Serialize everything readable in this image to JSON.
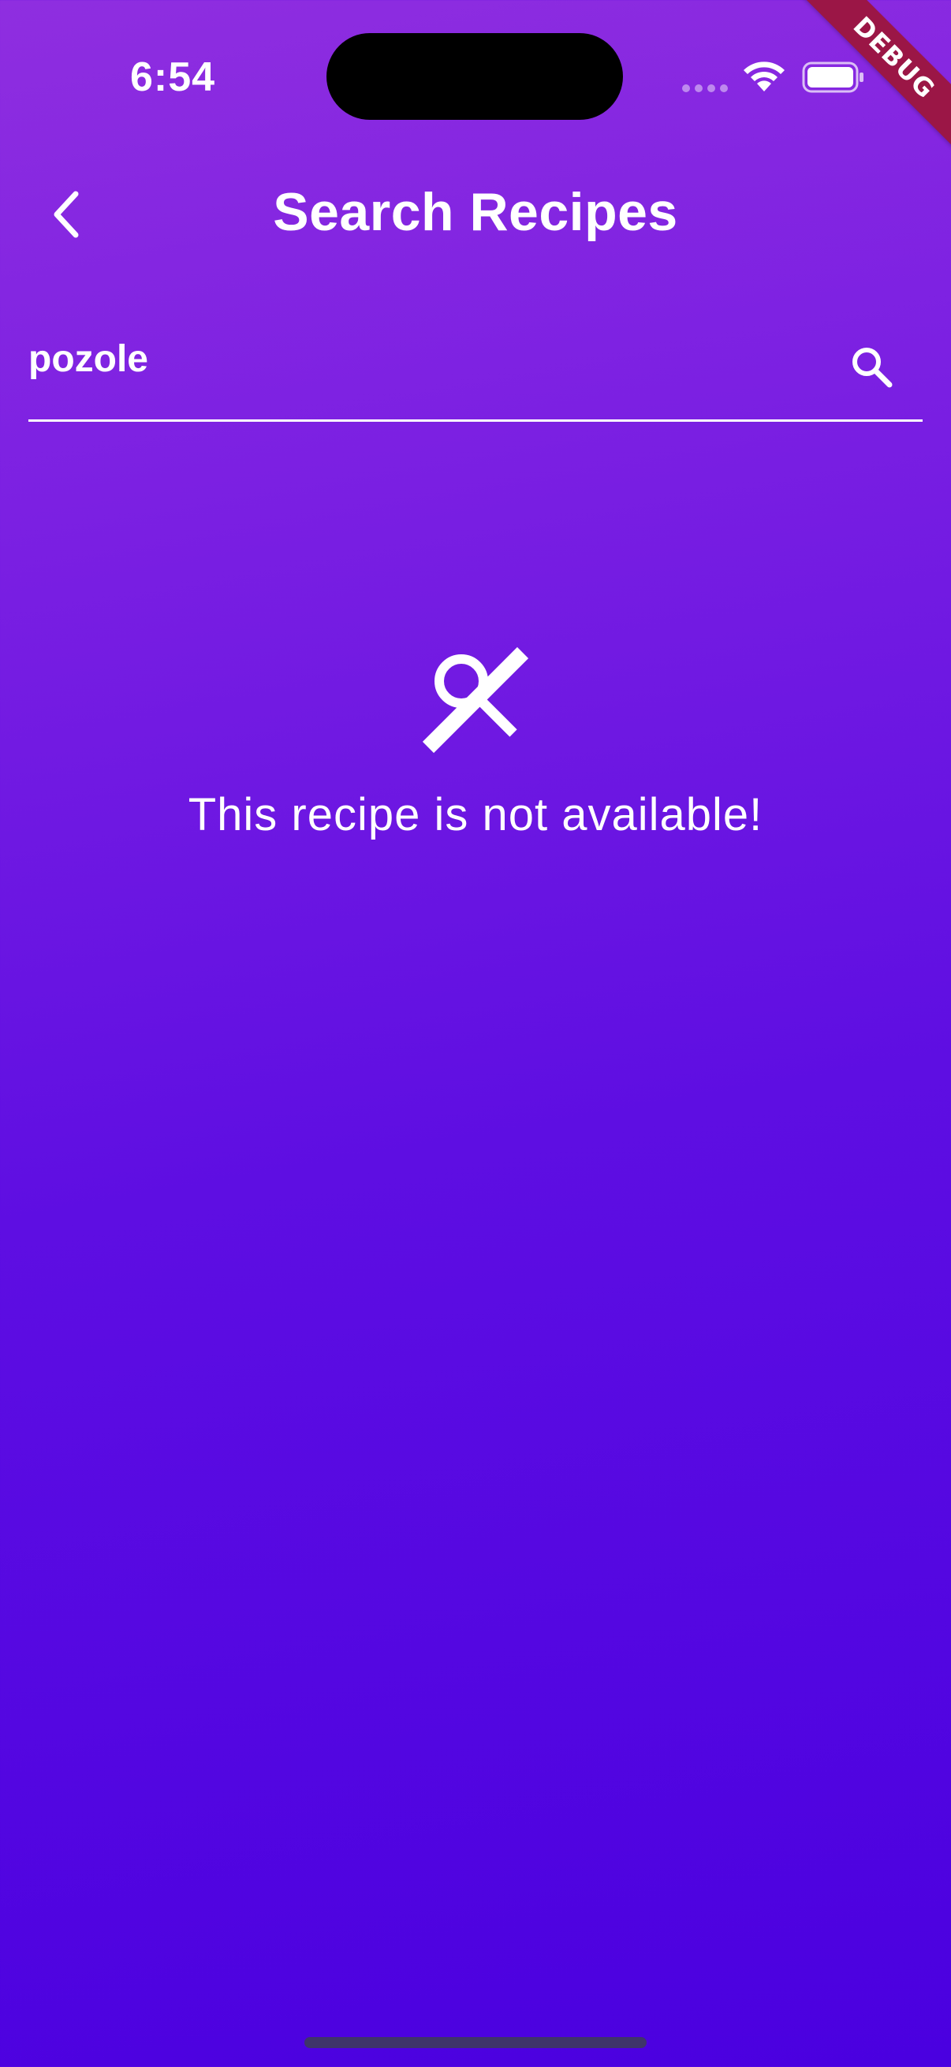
{
  "status_bar": {
    "time": "6:54"
  },
  "debug_banner": {
    "label": "DEBUG",
    "color": "#9b1646"
  },
  "app_bar": {
    "title": "Search Recipes",
    "back_icon": "chevron-left-icon"
  },
  "search": {
    "value": "pozole",
    "button_icon": "search-icon"
  },
  "empty_state": {
    "icon": "search-off-icon",
    "message": "This recipe is not available!"
  },
  "theme": {
    "gradient_top": "#8f2ee0",
    "gradient_bottom": "#4a00e0",
    "text_color": "#ffffff"
  }
}
